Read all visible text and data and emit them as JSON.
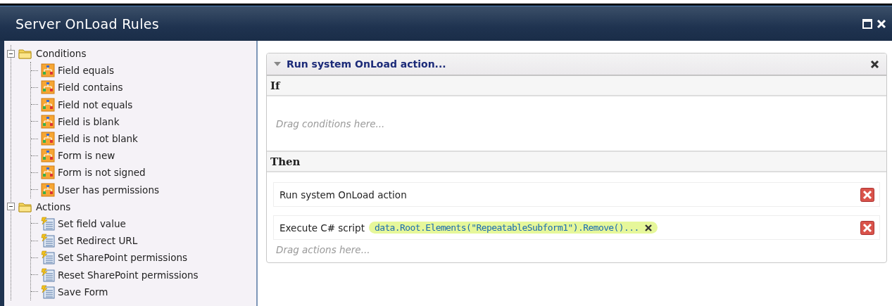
{
  "window": {
    "title": "Server OnLoad Rules"
  },
  "toolbox": [
    {
      "label": "Conditions",
      "expanded": true,
      "kind": "condition",
      "children": [
        {
          "label": "Field equals"
        },
        {
          "label": "Field contains"
        },
        {
          "label": "Field not equals"
        },
        {
          "label": "Field is blank"
        },
        {
          "label": "Field is not blank"
        },
        {
          "label": "Form is new"
        },
        {
          "label": "Form is not signed"
        },
        {
          "label": "User has permissions"
        }
      ]
    },
    {
      "label": "Actions",
      "expanded": true,
      "kind": "action",
      "children": [
        {
          "label": "Set field value"
        },
        {
          "label": "Set Redirect URL"
        },
        {
          "label": "Set SharePoint permissions"
        },
        {
          "label": "Reset SharePoint permissions"
        },
        {
          "label": "Save Form"
        }
      ]
    }
  ],
  "rule": {
    "title": "Run system OnLoad action...",
    "expanded": true,
    "if_label": "If",
    "conditions_placeholder": "Drag conditions here...",
    "then_label": "Then",
    "actions": [
      {
        "label": "Run system OnLoad action"
      },
      {
        "label": "Execute C# script",
        "parameter": "data.Root.Elements(\"RepeatableSubform1\").Remove()..."
      }
    ],
    "actions_placeholder": "Drag actions here..."
  }
}
